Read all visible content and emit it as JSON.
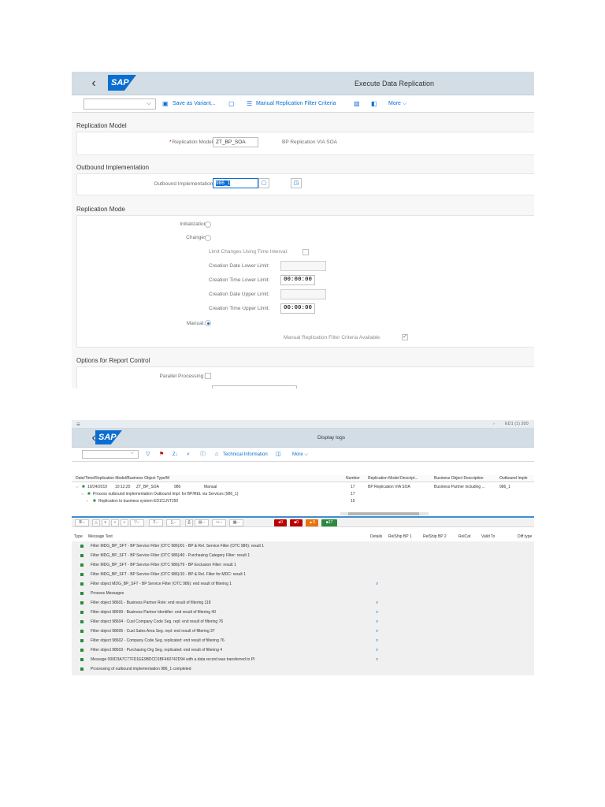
{
  "screen1": {
    "title": "Execute Data Replication",
    "logo": "SAP",
    "toolbar": {
      "save_variant": "Save as Variant...",
      "manual_filter": "Manual Replication Filter Criteria",
      "more": "More"
    },
    "sections": {
      "replication_model": "Replication Model",
      "outbound": "Outbound Implementation",
      "mode": "Replication Mode",
      "options": "Options for Report Control"
    },
    "replication_model": {
      "label": "Replication Model:",
      "value": "ZT_BP_SOA",
      "description": "BP Replication VIA SOA"
    },
    "outbound": {
      "label": "Outbound Implementation:",
      "value": "986_1"
    },
    "mode": {
      "initialization": "Initialization:",
      "changes": "Changes:",
      "limit_changes": "Limit Changes Using Time Interval:",
      "creation_date_lower": "Creation Date Lower Limit:",
      "creation_time_lower": "Creation Time Lower Limit:",
      "creation_time_lower_value": "00:00:00",
      "creation_date_upper": "Creation Date Upper Limit:",
      "creation_time_upper": "Creation Time Upper Limit:",
      "creation_time_upper_value": "00:00:00",
      "manual": "Manual:",
      "manual_filter_available": "Manual Replication Filter Criteria Available:"
    },
    "options": {
      "parallel": "Parallel Processing:"
    }
  },
  "screen2": {
    "topstrip_right": "ED1 (1) 200",
    "title": "Display logs",
    "logo": "SAP",
    "toolbar": {
      "technical_info": "Technical Information",
      "more": "More"
    },
    "tree_columns": [
      "Date/Time/Replication Model/Business Object Type/M",
      "Number",
      "Replication Model Descript...",
      "Business Object Description",
      "Outbound Imple"
    ],
    "tree_rows": [
      {
        "date": "10/24/2019",
        "time": "10:12:20",
        "model": "ZT_BP_SOA",
        "id": "986",
        "type": "Manual",
        "number": "17",
        "model_desc": "BP Replication VIA SOA",
        "bo_desc": "Business Partner including ...",
        "outbound": "986_1"
      },
      {
        "text": "Process outbound implementation Outbound Impl. for BP/REL via Services (986_1)",
        "number": "17"
      },
      {
        "text": "Replication to business system ED1CLNT250",
        "number": "15"
      }
    ],
    "status_counts": {
      "red1": "0",
      "red2": "0",
      "yellow": "0",
      "green": "17"
    },
    "msg_columns": {
      "type": "Type",
      "text": "Message Text",
      "details": "Details",
      "relship1": "RelShip BP 1",
      "relship2": "RelShip BP 2",
      "relcat": "RelCat",
      "valid_to": "Valid To",
      "difftype": "Diff.type"
    },
    "messages": [
      {
        "text": "Filter MDG_BP_SFT - BP Service Filter (OTC 986)/01 - BP & Rel. Service Filter (OTC 986): result 1",
        "detail": false
      },
      {
        "text": "Filter MDG_BP_SFT - BP Service Filter (OTC 986)/40 - Purchasing Category Filter: result 1",
        "detail": false
      },
      {
        "text": "Filter MDG_BP_SFT - BP Service Filter (OTC 986)/79 - BP Exclusion Filter: result 1",
        "detail": false
      },
      {
        "text": "Filter MDG_BP_SFT - BP Service Filter (OTC 986)/10 - BP & Rel. Filter for MDC: result 1",
        "detail": false
      },
      {
        "text": "Filter object MDG_BP_SFT - BP Service Filter (OTC 986): end result of filtering 1",
        "detail": true
      },
      {
        "text": "Process Messages",
        "detail": false
      },
      {
        "text": "Filter object 98601 - Business Partner Role: end result of filtering 118",
        "detail": true
      },
      {
        "text": "Filter object 98699 - Business Partner Identifier: end result of filtering 40",
        "detail": true
      },
      {
        "text": "Filter object 98604 - Cust Company Code Seg. repl: end result of filtering 76",
        "detail": true
      },
      {
        "text": "Filter object 98605 - Cust Sales Area Seg. repl: end result of filtering 37",
        "detail": true
      },
      {
        "text": "Filter object 98602 - Company Code Seg. replicated: end result of filtering 76",
        "detail": true
      },
      {
        "text": "Filter object 98603 - Purchasing Org Seg. replicated: end result of filtering 4",
        "detail": true
      },
      {
        "text": "Message 000D3A7C77FD1EE9BDCD1BF460742D94 with a data record was transferred to PI",
        "detail": true
      },
      {
        "text": "Processing of outbound implementation 986_1 completed",
        "detail": false
      }
    ]
  }
}
